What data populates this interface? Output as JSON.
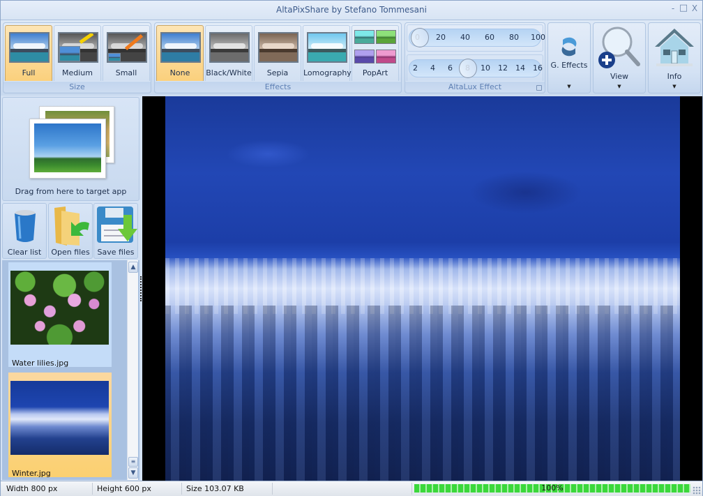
{
  "window": {
    "title": "AltaPixShare by Stefano Tommesani",
    "controls": {
      "minimize": "-",
      "maximize": "□",
      "close": "X"
    }
  },
  "ribbon": {
    "size_group": {
      "label": "Size",
      "buttons": [
        {
          "label": "Full",
          "icon": "full-size-image-icon",
          "active": true
        },
        {
          "label": "Medium",
          "icon": "medium-size-image-icon",
          "active": false
        },
        {
          "label": "Small",
          "icon": "small-size-image-icon",
          "active": false
        }
      ]
    },
    "effects_group": {
      "label": "Effects",
      "buttons": [
        {
          "label": "None",
          "icon": "no-effect-image-icon",
          "active": true
        },
        {
          "label": "Black/White",
          "icon": "black-white-image-icon",
          "active": false
        },
        {
          "label": "Sepia",
          "icon": "sepia-image-icon",
          "active": false
        },
        {
          "label": "Lomography",
          "icon": "lomography-image-icon",
          "active": false
        },
        {
          "label": "PopArt",
          "icon": "popart-image-icon",
          "active": false
        }
      ]
    },
    "altalux_group": {
      "label": "AltaLux Effect",
      "strength_slider": {
        "ticks": [
          "0",
          "20",
          "40",
          "60",
          "80",
          "100"
        ],
        "value": 0,
        "min": 0,
        "max": 100
      },
      "scale_slider": {
        "ticks": [
          "2",
          "4",
          "6",
          "8",
          "10",
          "12",
          "14",
          "16"
        ],
        "value": 8,
        "min": 2,
        "max": 16
      },
      "launcher_icon": "dialog-launcher-icon"
    },
    "geffects": {
      "label": "G. Effects",
      "icon": "swirl-effects-icon"
    },
    "view": {
      "label": "View",
      "icon": "magnifier-zoom-icon"
    },
    "info": {
      "label": "Info",
      "icon": "house-icon"
    }
  },
  "left_panel": {
    "drag_label": "Drag from here to target app",
    "actions": [
      {
        "label": "Clear list",
        "icon": "recycle-bin-icon"
      },
      {
        "label": "Open files",
        "icon": "open-folder-icon"
      },
      {
        "label": "Save files",
        "icon": "save-floppy-icon"
      }
    ],
    "files": [
      {
        "name": "Water lilies.jpg",
        "selected": false
      },
      {
        "name": "Winter.jpg",
        "selected": true
      }
    ]
  },
  "status_bar": {
    "width": "Width 800 px",
    "height": "Height 600 px",
    "size": "Size 103.07 KB",
    "progress_text": "100%",
    "progress_value": 100
  },
  "colors": {
    "active_button": "#fbd07c",
    "ribbon_bg": "#d4e2f4",
    "group_label": "#5d7fb3",
    "progress_green": "#3bd83b",
    "selected_file": "#fbd38a",
    "unselected_file": "#c4dcf8"
  }
}
